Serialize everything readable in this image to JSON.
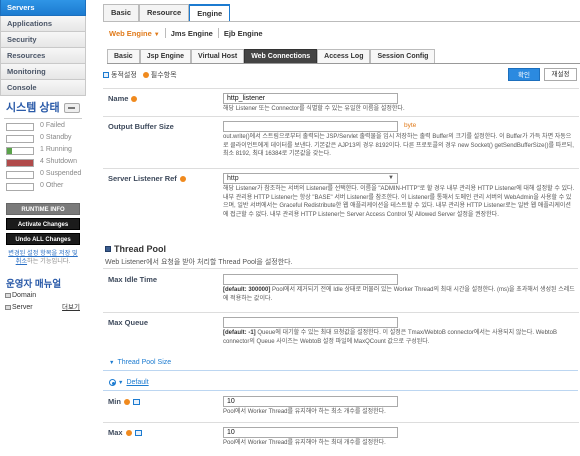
{
  "sidebar": {
    "nav": [
      "Servers",
      "Applications",
      "Security",
      "Resources",
      "Monitoring",
      "Console"
    ],
    "system_status": {
      "title": "시스템 상태",
      "rows": [
        {
          "count": "0",
          "label": "Failed",
          "color": "#ffffff",
          "level": 0
        },
        {
          "count": "0",
          "label": "Standby",
          "color": "#ffffff",
          "level": 0
        },
        {
          "count": "1",
          "label": "Running",
          "color": "#5aa34a",
          "level": 0.2
        },
        {
          "count": "4",
          "label": "Shutdown",
          "color": "#b04a4a",
          "level": 1
        },
        {
          "count": "0",
          "label": "Suspended",
          "color": "#ffffff",
          "level": 0
        },
        {
          "count": "0",
          "label": "Other",
          "color": "#ffffff",
          "level": 0
        }
      ]
    },
    "runtime_info": "RUNTIME INFO",
    "activate_changes": "Activate Changes",
    "undo_changes": "Undo ALL Changes",
    "note_link": "변경된 설정 항목을 저장 및 취소",
    "note_rest": "하는 기능입니다.",
    "operator_menu": "운영자 매뉴얼",
    "menu_items": [
      "Domain",
      "Server"
    ],
    "more": "더보기"
  },
  "tabs": [
    "Basic",
    "Resource",
    "Engine"
  ],
  "subtabs": [
    "Web Engine",
    "Jms Engine",
    "Ejb Engine"
  ],
  "tabs2": [
    "Basic",
    "Jsp Engine",
    "Virtual Host",
    "Web Connections",
    "Access Log",
    "Session Config"
  ],
  "legend": {
    "dynamic": "동적설정",
    "required": "필수항목"
  },
  "buttons": {
    "confirm": "확인",
    "reset": "재설정"
  },
  "form": {
    "name": {
      "label": "Name",
      "value": "http_listener",
      "desc": "해당 Listener 또는 Connector를 식별할 수 있는 유일한 이름을 설정한다."
    },
    "output_buffer": {
      "label": "Output Buffer Size",
      "value": "",
      "unit": "byte",
      "desc": "out.write()에서 스트림으로부터 출력되는 JSP/Servlet 출력물을 임시 저장하는 출력 Buffer의 크기를 설정한다. 이 Buffer가 가득 차면 자동으로 클라이언트에게 데이터를 보낸다. 기본값은 AJP13의 경우 8192이다. 다른 프로토콜의 경우 new Socket() getSendBufferSize()를 따르되, 최소 8192, 최대 16384로 기본값을 갖는다."
    },
    "listener_ref": {
      "label": "Server Listener Ref",
      "value": "http",
      "desc": "해당 Listener가 참조하는 서버의 Listener를 선택한다. 이름을 \"ADMIN-HTTP\"로 할 경우 내부 관리용 HTTP Listener에 대해 설정할 수 있다. 내부 관리용 HTTP Listener는 항상 \"BASE\" 서버 Listener를 참조한다. 이 Listener를 통해서 도메인 관리 서버의 WebAdmin을 사용할 수 있으며, 일반 서버에서는 Graceful Redistribute한 웹 애플리케이션을 테스트할 수 있다. 내부 관리용 HTTP Listener로는 일반 웹 애플리케이션에 접근할 수 없다. 내부 관리용 HTTP Listener는 Server Access Control 및 Allowed Server 설정을 권장한다."
    },
    "thread_pool": {
      "title": "Thread Pool",
      "subtitle": "Web Listener에서 요청을 받아 처리할 Thread Pool을 설정한다."
    },
    "max_idle": {
      "label": "Max Idle Time",
      "value": "",
      "default": "[default: 300000]",
      "desc": "Pool에서 제거되기 전에 Idle 상태로 머물러 있는 Worker Thread의 최대 시간을 설정한다. (ms)을 초과해서 생성된 스레드에 적용하는 값이다."
    },
    "max_queue": {
      "label": "Max Queue",
      "value": "",
      "default": "[default: -1]",
      "desc": "Queue에 대기할 수 있는 최대 요청값을 설정한다. 이 설정은 Tmax/WebtoB connector에서는 사용되지 않는다. WebtoB connector의 Queue 사이즈는 WebtoB 설정 파일에 MaxQCount 값으로 구성된다."
    },
    "thread_pool_size": "Thread Pool Size",
    "default_option": "Default",
    "min": {
      "label": "Min",
      "value": "10",
      "desc": "Pool에서 Worker Thread를 유지해야 하는 최소 개수를 설정한다."
    },
    "max": {
      "label": "Max",
      "value": "10",
      "desc": "Pool에서 Worker Thread를 유지해야 하는 최대 개수를 설정한다."
    }
  }
}
